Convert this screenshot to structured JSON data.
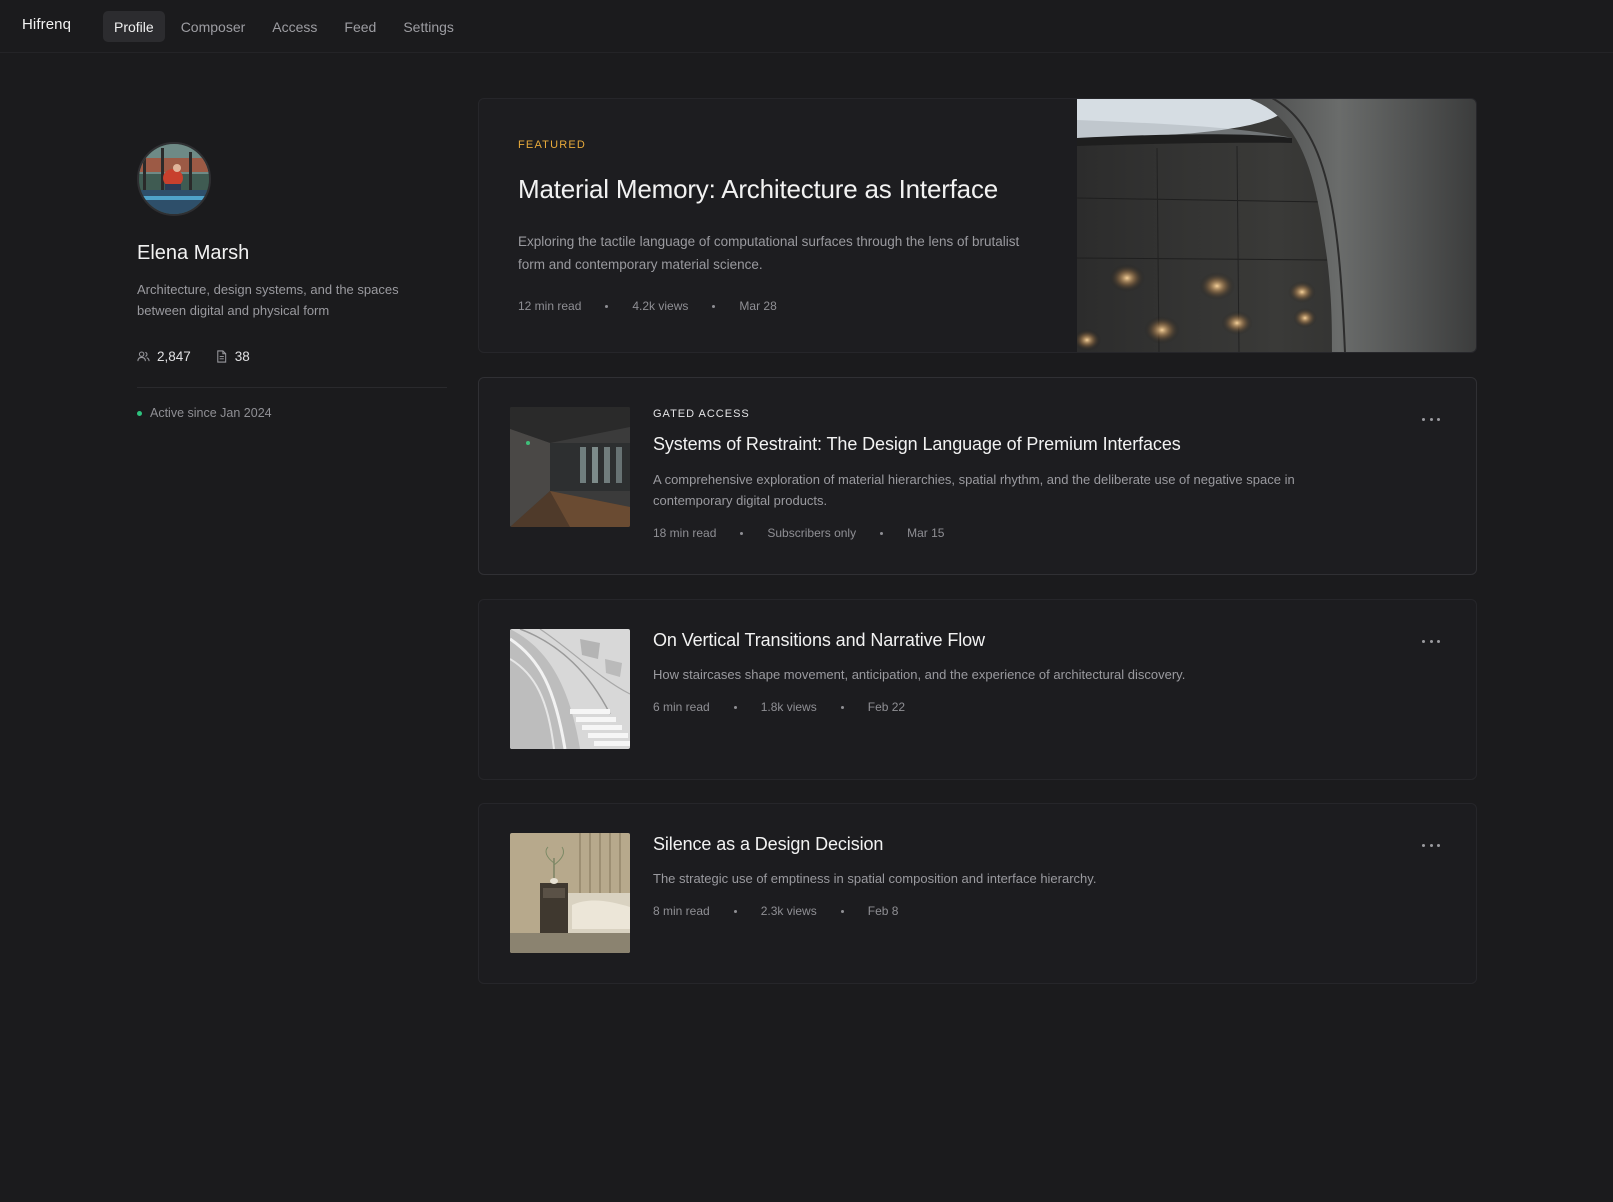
{
  "app": {
    "brand": "Hifrenq"
  },
  "nav": {
    "tabs": [
      {
        "label": "Profile",
        "active": true
      },
      {
        "label": "Composer"
      },
      {
        "label": "Access"
      },
      {
        "label": "Feed"
      },
      {
        "label": "Settings"
      }
    ]
  },
  "profile": {
    "name": "Elena Marsh",
    "bio": "Architecture, design systems, and the spaces between digital and physical form",
    "followers": "2,847",
    "posts": "38",
    "active_since": "Active since Jan 2024",
    "icons": {
      "followers": "users-icon",
      "posts": "document-icon"
    }
  },
  "featured": {
    "label": "FEATURED",
    "title": "Material Memory: Architecture as Interface",
    "description": "Exploring the tactile language of computational surfaces through the lens of brutalist form and contemporary material science.",
    "read_time": "12 min read",
    "views": "4.2k views",
    "date": "Mar 28"
  },
  "articles": [
    {
      "label": "GATED ACCESS",
      "title": "Systems of Restraint: The Design Language of Premium Interfaces",
      "description": "A comprehensive exploration of material hierarchies, spatial rhythm, and the deliberate use of negative space in contemporary digital products.",
      "read_time": "18 min read",
      "stat": "Subscribers only",
      "date": "Mar 15"
    },
    {
      "label": "",
      "title": "On Vertical Transitions and Narrative Flow",
      "description": "How staircases shape movement, anticipation, and the experience of architectural discovery.",
      "read_time": "6 min read",
      "stat": "1.8k views",
      "date": "Feb 22"
    },
    {
      "label": "",
      "title": "Silence as a Design Decision",
      "description": "The strategic use of emptiness in spatial composition and interface hierarchy.",
      "read_time": "8 min read",
      "stat": "2.3k views",
      "date": "Feb 8"
    }
  ],
  "colors": {
    "background": "#1b1b1d",
    "accent_featured": "#e7a93a",
    "status_active": "#2ec27e"
  }
}
